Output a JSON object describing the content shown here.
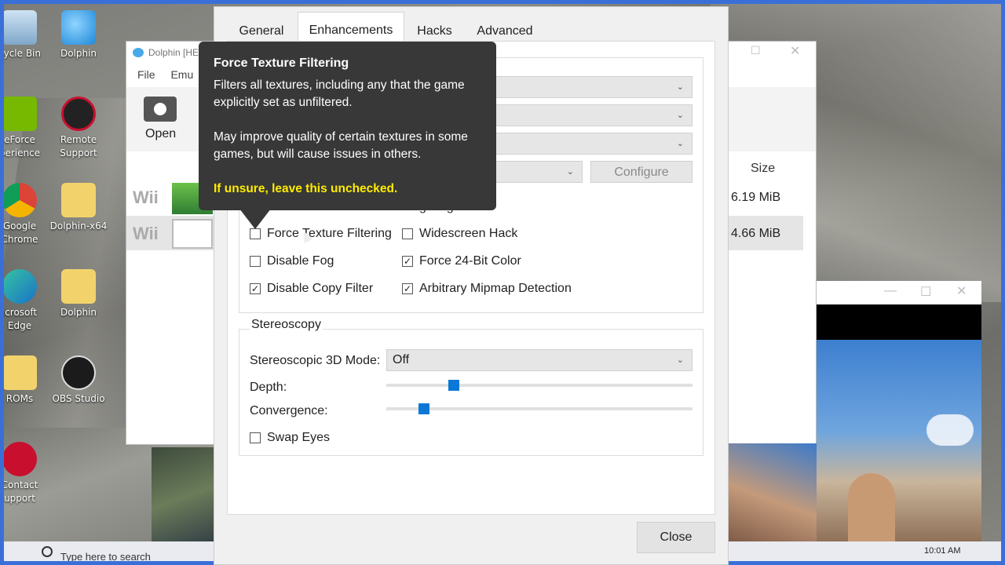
{
  "desktop": {
    "icons": [
      {
        "label": "cycle Bin"
      },
      {
        "label": "Dolphin"
      },
      {
        "label": "eForce\nperience"
      },
      {
        "label": "Remote\nSupport"
      },
      {
        "label": "Google\nChrome"
      },
      {
        "label": "Dolphin-x64"
      },
      {
        "label": "icrosoft\nEdge"
      },
      {
        "label": "Dolphin"
      },
      {
        "label": "ROMs"
      },
      {
        "label": "OBS Studio"
      },
      {
        "label": "Contact\nupport"
      }
    ]
  },
  "main_window": {
    "title": "Dolphin [HE",
    "menu": [
      "File",
      "Emu"
    ],
    "toolbar_open": "Open",
    "size_header": "Size",
    "rows": [
      {
        "platform": "Wii",
        "size": "6.19 MiB"
      },
      {
        "platform": "Wii",
        "size": "4.66 MiB"
      }
    ]
  },
  "dialog": {
    "tabs": [
      "General",
      "Enhancements",
      "Hacks",
      "Advanced"
    ],
    "active_tab": "Enhancements",
    "combo1_partial": ")",
    "configure_label": "Configure",
    "row_partial_right": "ghting",
    "checkboxes": [
      {
        "label": "Force Texture Filtering",
        "checked": false
      },
      {
        "label": "Widescreen Hack",
        "checked": false
      },
      {
        "label": "Disable Fog",
        "checked": false
      },
      {
        "label": "Force 24-Bit Color",
        "checked": true
      },
      {
        "label": "Disable Copy Filter",
        "checked": true
      },
      {
        "label": "Arbitrary Mipmap Detection",
        "checked": true
      }
    ],
    "stereoscopy": {
      "group_title": "Stereoscopy",
      "mode_label": "Stereoscopic 3D Mode:",
      "mode_value": "Off",
      "depth_label": "Depth:",
      "depth_level": 0.21,
      "convergence_label": "Convergence:",
      "convergence_level": 0.11,
      "swap_eyes_label": "Swap Eyes",
      "swap_eyes_checked": false
    },
    "close_label": "Close",
    "check_glyph": "✓"
  },
  "tooltip": {
    "title": "Force Texture Filtering",
    "paragraph1": "Filters all textures, including any that the game explicitly set as unfiltered.",
    "paragraph2": "May improve quality of certain textures in some games, but will cause issues in others.",
    "warning": "If unsure, leave this unchecked."
  },
  "taskbar": {
    "search_placeholder": "Type here to search",
    "time": "10:01 AM"
  },
  "colors": {
    "accent": "#0b78d7",
    "tooltip_bg": "#383838",
    "tooltip_warn": "#ffec00",
    "frame": "#3b6fd8"
  }
}
